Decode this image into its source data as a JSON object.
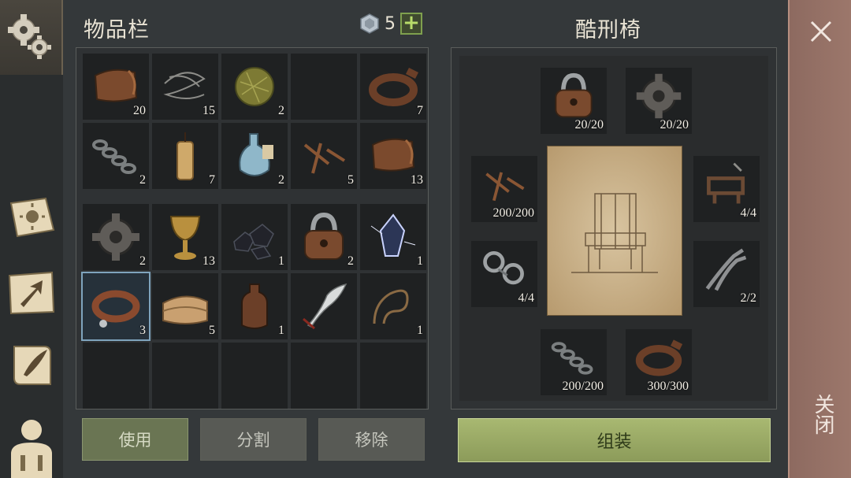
{
  "inventory": {
    "title": "物品栏",
    "currency": {
      "amount": "5",
      "plus": "+"
    },
    "rows1": [
      {
        "icon": "leather-icon",
        "count": "20"
      },
      {
        "icon": "wire-icon",
        "count": "15"
      },
      {
        "icon": "hay-ball-icon",
        "count": "2"
      },
      {
        "icon": "empty",
        "count": ""
      },
      {
        "icon": "leather-strap-icon",
        "count": "7"
      },
      {
        "icon": "chain-icon",
        "count": "2"
      },
      {
        "icon": "candle-icon",
        "count": "7"
      },
      {
        "icon": "potion-bottle-icon",
        "count": "2"
      },
      {
        "icon": "nails-icon",
        "count": "5"
      },
      {
        "icon": "leather-icon",
        "count": "13"
      }
    ],
    "rows2": [
      {
        "icon": "gear-part-icon",
        "count": "2"
      },
      {
        "icon": "goblet-icon",
        "count": "13"
      },
      {
        "icon": "coal-icon",
        "count": "1"
      },
      {
        "icon": "padlock-icon",
        "count": "2"
      },
      {
        "icon": "crystal-icon",
        "count": "1"
      },
      {
        "icon": "collar-icon",
        "count": "3"
      },
      {
        "icon": "cloth-icon",
        "count": "5"
      },
      {
        "icon": "bottle-icon",
        "count": "1"
      },
      {
        "icon": "sword-icon",
        "count": ""
      },
      {
        "icon": "rope-icon",
        "count": "1"
      }
    ],
    "buttons": {
      "use": "使用",
      "split": "分割",
      "remove": "移除"
    }
  },
  "craft": {
    "title": "酷刑椅",
    "ingredients": {
      "padlock": "20/20",
      "gear": "20/20",
      "nails": "200/200",
      "frame": "4/4",
      "shackles": "4/4",
      "pliers": "2/2",
      "chain": "200/200",
      "strap": "300/300"
    },
    "assemble": "组装"
  },
  "close": {
    "label": "关闭"
  }
}
